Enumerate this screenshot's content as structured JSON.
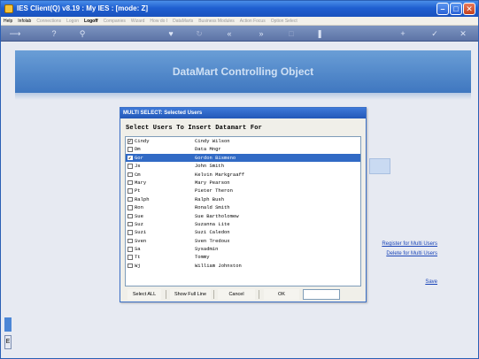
{
  "titlebar": {
    "title": "IES Client(Q) v8.19 : My IES :        [mode: Z]"
  },
  "menubar": {
    "items": [
      {
        "label": "Help",
        "enabled": true
      },
      {
        "label": "Infolab",
        "enabled": true
      },
      {
        "label": "Connections",
        "enabled": false
      },
      {
        "label": "Logon",
        "enabled": false
      },
      {
        "label": "Logoff",
        "enabled": true,
        "bold": true
      },
      {
        "label": "Companies",
        "enabled": false
      },
      {
        "label": "Wizard",
        "enabled": false
      },
      {
        "label": "How do I",
        "enabled": false
      },
      {
        "label": "DataMarts",
        "enabled": false
      },
      {
        "label": "Business Modules",
        "enabled": false
      },
      {
        "label": "Action Focus",
        "enabled": false
      },
      {
        "label": "Option Select",
        "enabled": false
      }
    ]
  },
  "toolbar": {
    "icons": [
      "back-arrow-icon",
      "help-icon",
      "search-icon",
      "heart-icon",
      "refresh-icon",
      "rewind-icon",
      "fast-forward-icon",
      "stop-icon",
      "pause-icon",
      "plus-icon",
      "check-icon",
      "close-icon"
    ]
  },
  "banner": {
    "heading": "DataMart Controlling Object"
  },
  "dialog": {
    "title": "MULTI SELECT: Selected Users",
    "prompt": "Select Users To Insert Datamart For",
    "rows": [
      {
        "code": "Cindy",
        "name": "Cindy Wilson",
        "checked": true,
        "selected": false
      },
      {
        "code": "Dm",
        "name": "Data Mngr",
        "checked": false,
        "selected": false
      },
      {
        "code": "Gor",
        "name": "Gordon Bismeno",
        "checked": true,
        "selected": true
      },
      {
        "code": "Js",
        "name": "John Smith",
        "checked": false,
        "selected": false
      },
      {
        "code": "Cm",
        "name": "Kelvin Markgraaff",
        "checked": false,
        "selected": false
      },
      {
        "code": "Mary",
        "name": "Mary Pearson",
        "checked": false,
        "selected": false
      },
      {
        "code": "Pt",
        "name": "Pieter Theron",
        "checked": false,
        "selected": false
      },
      {
        "code": "Ralph",
        "name": "Ralph Bush",
        "checked": false,
        "selected": false
      },
      {
        "code": "Ron",
        "name": "Ronald Smith",
        "checked": false,
        "selected": false
      },
      {
        "code": "Sue",
        "name": "Sue Bartholomew",
        "checked": false,
        "selected": false
      },
      {
        "code": "Suz",
        "name": "Suzanna Lite",
        "checked": false,
        "selected": false
      },
      {
        "code": "Suzi",
        "name": "Suzi Caledon",
        "checked": false,
        "selected": false
      },
      {
        "code": "Sven",
        "name": "Sven Tredoux",
        "checked": false,
        "selected": false
      },
      {
        "code": "Sa",
        "name": "Sysadmin",
        "checked": false,
        "selected": false
      },
      {
        "code": "Tt",
        "name": "Tommy",
        "checked": false,
        "selected": false
      },
      {
        "code": "Wj",
        "name": "William Johnston",
        "checked": false,
        "selected": false
      }
    ],
    "buttons": {
      "select_all": "Select ALL",
      "show_full_line": "Show Full Line",
      "cancel": "Cancel",
      "ok": "OK"
    },
    "input_value": ""
  },
  "links": {
    "register": "Register for Multi Users",
    "delete": "Delete for Multi Users",
    "save": "Save"
  },
  "left_strip": {
    "label": "E"
  },
  "colors": {
    "accent": "#316ac5",
    "titlebar": "#1f5fd0",
    "banner": "#5a8fd0"
  }
}
